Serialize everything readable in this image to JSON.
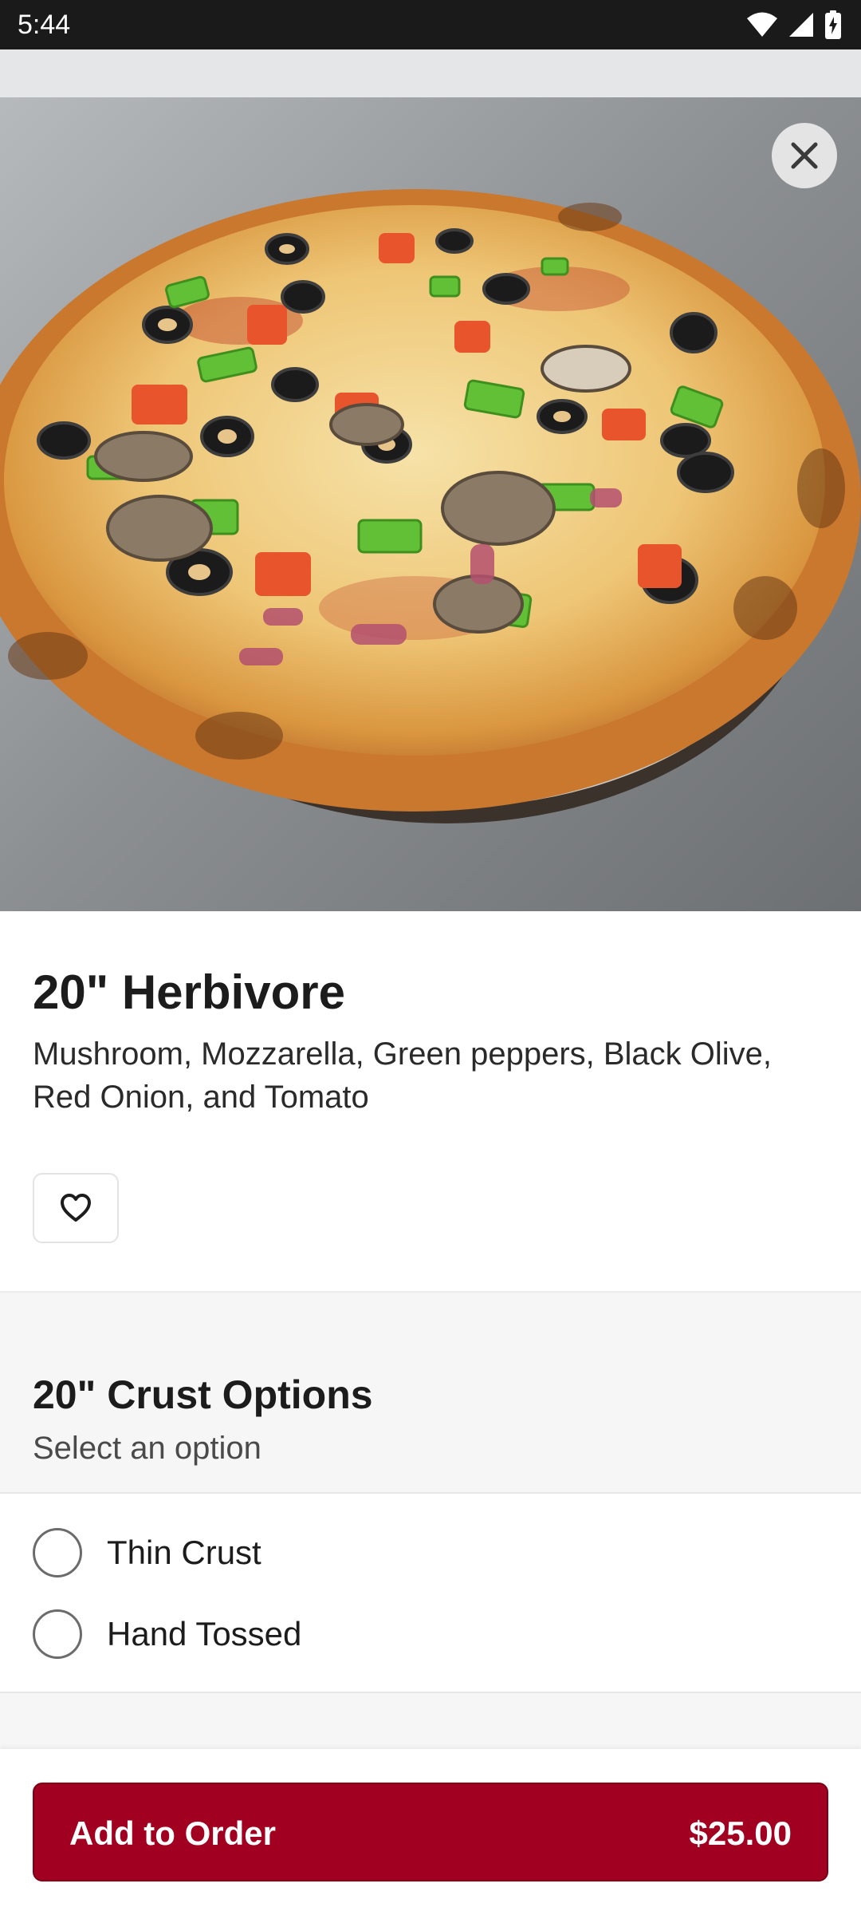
{
  "status_bar": {
    "time": "5:44",
    "icons": [
      "wifi-icon",
      "cellular-signal-icon",
      "battery-charging-icon"
    ]
  },
  "hero": {
    "image_subject": "vegetable pizza",
    "close_icon": "close-icon"
  },
  "item": {
    "title": "20\" Herbivore",
    "description": "Mushroom, Mozzarella, Green peppers, Black Olive, Red Onion, and Tomato",
    "favorite_icon": "heart-outline-icon"
  },
  "options": {
    "title": "20\" Crust Options",
    "subtitle": "Select an option",
    "items": [
      {
        "label": "Thin Crust",
        "selected": false
      },
      {
        "label": "Hand Tossed",
        "selected": false
      }
    ]
  },
  "action": {
    "label": "Add to Order",
    "price": "$25.00"
  },
  "colors": {
    "accent": "#a10020",
    "status_bar": "#1a1a1a",
    "section_background": "#f6f6f6"
  }
}
